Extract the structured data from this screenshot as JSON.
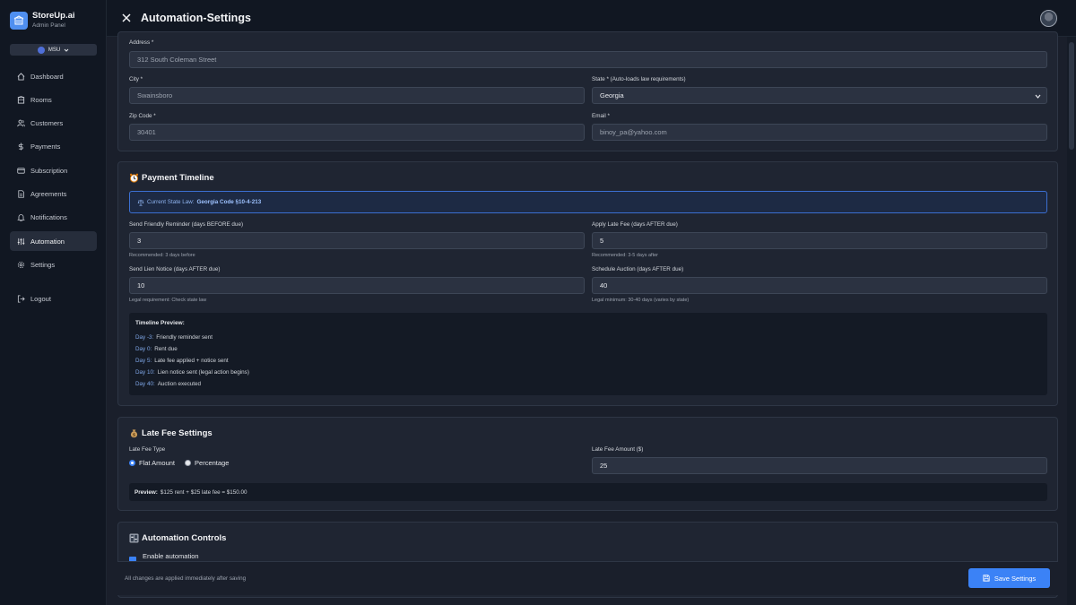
{
  "brand": {
    "name": "StoreUp.ai",
    "subtitle": "Admin Panel"
  },
  "store_selector": {
    "value": "MSU"
  },
  "nav": [
    {
      "label": "Dashboard",
      "icon": "home-icon"
    },
    {
      "label": "Rooms",
      "icon": "building-icon"
    },
    {
      "label": "Customers",
      "icon": "users-icon"
    },
    {
      "label": "Payments",
      "icon": "dollar-icon"
    },
    {
      "label": "Subscription",
      "icon": "card-icon"
    },
    {
      "label": "Agreements",
      "icon": "document-icon"
    },
    {
      "label": "Notifications",
      "icon": "bell-icon"
    },
    {
      "label": "Automation",
      "icon": "sliders-icon",
      "active": true
    },
    {
      "label": "Settings",
      "icon": "gear-icon"
    }
  ],
  "logout": {
    "label": "Logout"
  },
  "header": {
    "title": "Automation-Settings"
  },
  "address_card": {
    "address_label": "Address *",
    "address_value": "312 South Coleman Street",
    "city_label": "City *",
    "city_value": "Swainsboro",
    "state_label": "State * (Auto-loads law requirements)",
    "state_value": "Georgia",
    "zip_label": "Zip Code *",
    "zip_value": "30401",
    "email_label": "Email *",
    "email_value": "binoy_pa@yahoo.com"
  },
  "payment_timeline": {
    "title": "Payment Timeline",
    "law_prefix": "Current State Law:",
    "law_code": "Georgia Code §10-4-213",
    "reminder_label": "Send Friendly Reminder (days BEFORE due)",
    "reminder_value": "3",
    "reminder_hint": "Recommended: 3 days before",
    "late_fee_label": "Apply Late Fee (days AFTER due)",
    "late_fee_value": "5",
    "late_fee_hint": "Recommended: 3-5 days after",
    "lien_label": "Send Lien Notice (days AFTER due)",
    "lien_value": "10",
    "lien_hint": "Legal requirement: Check state law",
    "auction_label": "Schedule Auction (days AFTER due)",
    "auction_value": "40",
    "auction_hint": "Legal minimum: 30-40 days (varies by state)",
    "preview_title": "Timeline Preview:",
    "preview": [
      {
        "day": "Day -3:",
        "text": "Friendly reminder sent"
      },
      {
        "day": "Day 0:",
        "text": "Rent due"
      },
      {
        "day": "Day 5:",
        "text": "Late fee applied + notice sent"
      },
      {
        "day": "Day 10:",
        "text": "Lien notice sent (legal action begins)"
      },
      {
        "day": "Day 40:",
        "text": "Auction executed"
      }
    ]
  },
  "late_fee": {
    "title": "Late Fee Settings",
    "type_label": "Late Fee Type",
    "option_flat": "Flat Amount",
    "option_percent": "Percentage",
    "amount_label": "Late Fee Amount ($)",
    "amount_value": "25",
    "preview_prefix": "Preview:",
    "preview_text": "$125 rent + $25 late fee = $150.00"
  },
  "automation_controls": {
    "title": "Automation Controls",
    "enable_label": "Enable automation"
  },
  "footer": {
    "note": "All changes are applied immediately after saving",
    "save_label": "Save Settings"
  },
  "colors": {
    "accent": "#3b82f6",
    "background": "#1a1f2b",
    "card": "#1f2532"
  }
}
